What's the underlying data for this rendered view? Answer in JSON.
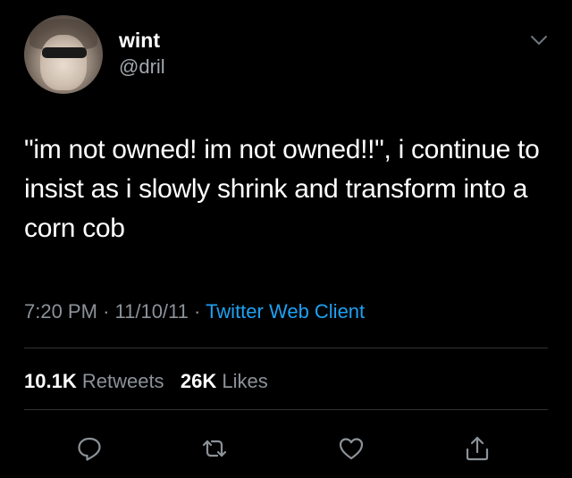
{
  "user": {
    "display_name": "wint",
    "handle": "@dril"
  },
  "tweet": {
    "text": "\"im not owned!  im not owned!!\", i continue to insist as i slowly shrink and transform into a corn cob",
    "time": "7:20 PM",
    "date": "11/10/11",
    "separator": "·",
    "source": "Twitter Web Client"
  },
  "stats": {
    "retweets_count": "10.1K",
    "retweets_label": "Retweets",
    "likes_count": "26K",
    "likes_label": "Likes"
  },
  "icons": {
    "menu": "chevron-down-icon",
    "reply": "reply-icon",
    "retweet": "retweet-icon",
    "like": "heart-icon",
    "share": "share-icon"
  },
  "colors": {
    "background": "#000000",
    "text": "#ffffff",
    "secondary_text": "#8b9298",
    "link": "#1da1f2",
    "divider": "#2f3336",
    "icon": "#8b9298"
  }
}
